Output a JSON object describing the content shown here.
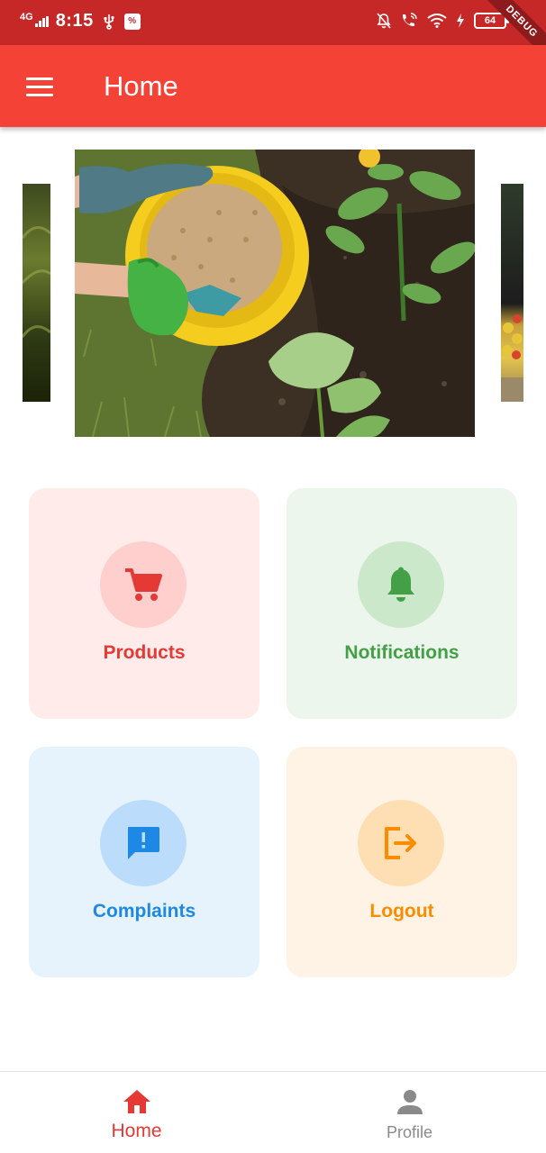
{
  "status_bar": {
    "network": "4G",
    "time": "8:15",
    "battery": "64"
  },
  "debug_banner": "DEBUG",
  "app_bar": {
    "title": "Home",
    "menu_icon": "menu-icon"
  },
  "carousel": {
    "slides": [
      "fertilizer-garden-image",
      "field-image",
      "vegetables-image"
    ]
  },
  "tiles": [
    {
      "label": "Products",
      "icon": "cart-icon",
      "color": "#e53935",
      "bg": "#ffebea",
      "circle": "#fecfcc"
    },
    {
      "label": "Notifications",
      "icon": "bell-icon",
      "color": "#43a047",
      "bg": "#edf6ec",
      "circle": "#cbe8cb"
    },
    {
      "label": "Complaints",
      "icon": "chat-alert-icon",
      "color": "#1e88e5",
      "bg": "#e6f3fd",
      "circle": "#bbddfb"
    },
    {
      "label": "Logout",
      "icon": "logout-icon",
      "color": "#fb8c00",
      "bg": "#fff3e5",
      "circle": "#fedfb4"
    }
  ],
  "bottom_nav": {
    "items": [
      {
        "label": "Home",
        "icon": "home-icon",
        "active": true,
        "color": "#e53935"
      },
      {
        "label": "Profile",
        "icon": "person-icon",
        "active": false,
        "color": "#8a8a8a"
      }
    ]
  }
}
